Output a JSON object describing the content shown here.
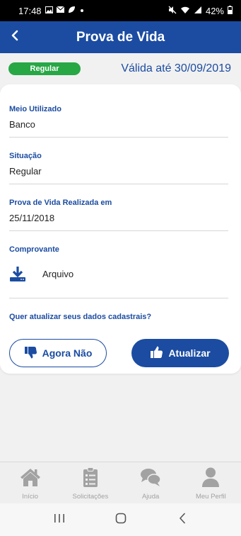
{
  "status_bar": {
    "time": "17:48",
    "battery": "42%",
    "notification_icons": [
      "image-icon",
      "mail-icon",
      "leaf-icon"
    ],
    "right_icons": [
      "mute-icon",
      "wifi-icon",
      "signal-icon",
      "battery-icon"
    ]
  },
  "header": {
    "title": "Prova de Vida",
    "back_icon": "chevron-left-icon"
  },
  "status": {
    "badge": "Regular",
    "badge_color": "#28a745",
    "validity": "Válida até 30/09/2019"
  },
  "details": {
    "method": {
      "label": "Meio Utilizado",
      "value": "Banco"
    },
    "situation": {
      "label": "Situação",
      "value": "Regular"
    },
    "date": {
      "label": "Prova de Vida Realizada em",
      "value": "25/11/2018"
    },
    "receipt": {
      "label": "Comprovante",
      "file": "Arquivo",
      "icon": "download-icon"
    }
  },
  "update_question": "Quer atualizar seus dados cadastrais?",
  "actions": {
    "decline": {
      "label": "Agora Não",
      "icon": "thumbs-down-icon"
    },
    "update": {
      "label": "Atualizar",
      "icon": "thumbs-up-icon"
    }
  },
  "nav": {
    "items": [
      {
        "label": "Início",
        "icon": "home-icon"
      },
      {
        "label": "Solicitações",
        "icon": "clipboard-icon"
      },
      {
        "label": "Ajuda",
        "icon": "chat-icon"
      },
      {
        "label": "Meu Perfil",
        "icon": "user-icon"
      }
    ]
  },
  "system_nav": [
    "recent-apps-icon",
    "home-button-icon",
    "back-icon"
  ],
  "colors": {
    "primary": "#1b4ca1",
    "badge_green": "#28a745",
    "nav_gray": "#a2a2a2",
    "background": "#f1f1f1"
  }
}
